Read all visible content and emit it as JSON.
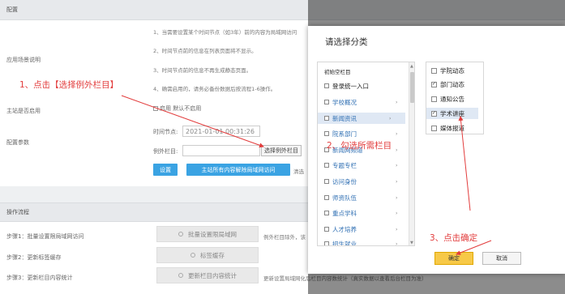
{
  "page": {
    "section_config": "配置",
    "scenario_label": "应用场景说明",
    "notes": [
      "1、当需要设置某个时间节点（如3年）前的内容为局域网访问",
      "2、时间节点前的信息在列表页面将不显示。",
      "3、时间节点前的信息不再生成静态页面。",
      "4、确需启用的，请务必备份数据后按流程1-6操作。"
    ],
    "main_site_label": "主站是否启用",
    "main_site_checkbox": "启用 默认不启用",
    "config_param_label": "配置参数",
    "time_node_label": "时间节点:",
    "time_node_value": "2021-01-01 00:31:26",
    "exception_label": "例外栏目:",
    "exception_value": "",
    "choose_exception_btn": "选择例外栏目",
    "set_btn": "设置",
    "main_all_btn": "主站所有内容解除局域网访问",
    "main_all_note": "清选",
    "section_ops": "操作流程",
    "steps": [
      {
        "label": "步骤1：批量设置限局域网访问",
        "button": "批量设置限局域网",
        "note": "例外栏目除外，该"
      },
      {
        "label": "步骤2：更新标签缓存",
        "button": "标签缓存",
        "note": ""
      },
      {
        "label": "步骤3：更新栏目内容统计",
        "button": "更新栏目内容统计",
        "note": "更新设置局域网化后栏目内容数统计（真实数据以查看后台栏目为准）"
      }
    ]
  },
  "annotations": {
    "step1": "1、点击【选择例外栏目】",
    "step2": "2、勾选所需栏目",
    "step3": "3、点击确定"
  },
  "dialog": {
    "title": "请选择分类",
    "left_items": [
      {
        "label": "初始空栏目",
        "checkbox": false,
        "arrow": false,
        "style": "black-small"
      },
      {
        "label": "登录统一入口",
        "checkbox": true,
        "arrow": false,
        "style": "black"
      },
      {
        "label": "学校概况",
        "checkbox": true,
        "arrow": true,
        "style": "link"
      },
      {
        "label": "新闻资讯",
        "checkbox": true,
        "arrow": true,
        "style": "selected"
      },
      {
        "label": "院系部门",
        "checkbox": true,
        "arrow": true,
        "style": "link"
      },
      {
        "label": "新闻网频道",
        "checkbox": true,
        "arrow": true,
        "style": "link"
      },
      {
        "label": "专题专栏",
        "checkbox": true,
        "arrow": true,
        "style": "link"
      },
      {
        "label": "访问身份",
        "checkbox": true,
        "arrow": true,
        "style": "link"
      },
      {
        "label": "师资队伍",
        "checkbox": true,
        "arrow": true,
        "style": "link"
      },
      {
        "label": "重点学科",
        "checkbox": true,
        "arrow": true,
        "style": "link"
      },
      {
        "label": "人才培养",
        "checkbox": true,
        "arrow": true,
        "style": "link"
      },
      {
        "label": "招生就业",
        "checkbox": true,
        "arrow": true,
        "style": "link"
      }
    ],
    "right_items": [
      {
        "label": "学院动态",
        "checked": false
      },
      {
        "label": "部门动态",
        "checked": true
      },
      {
        "label": "通知公告",
        "checked": false
      },
      {
        "label": "学术讲座",
        "checked": true
      },
      {
        "label": "媒体报道",
        "checked": false
      }
    ],
    "ok_btn": "确定",
    "cancel_btn": "取消"
  },
  "colors": {
    "accent_blue": "#3aa3e3",
    "annotation_red": "#e23c3c",
    "ok_yellow": "#f7c948"
  }
}
